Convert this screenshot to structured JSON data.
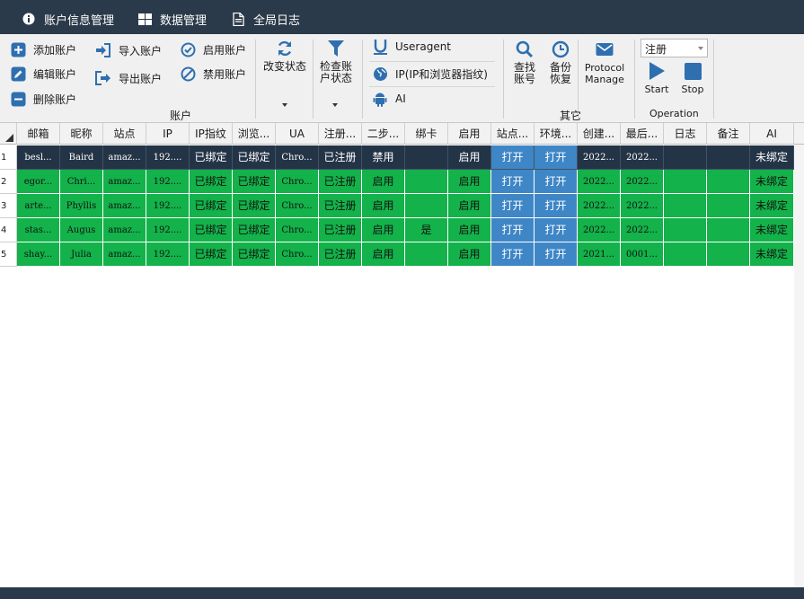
{
  "nav": {
    "tabs": [
      {
        "label": "账户信息管理",
        "icon": "info-icon"
      },
      {
        "label": "数据管理",
        "icon": "grid-icon"
      },
      {
        "label": "全局日志",
        "icon": "document-icon"
      }
    ]
  },
  "ribbon": {
    "account": {
      "add": "添加账户",
      "edit": "编辑账户",
      "delete": "删除账户",
      "import": "导入账户",
      "export": "导出账户",
      "enable": "启用账户",
      "disable": "禁用账户",
      "change_status": "改变状态",
      "check_line1": "检查账",
      "check_line2": "户状态",
      "group_label": "账户"
    },
    "middle": {
      "useragent": "Useragent",
      "ip": "IP(IP和浏览器指纹)",
      "ai": "AI"
    },
    "other": {
      "find_line1": "查找",
      "find_line2": "账号",
      "backup_line1": "备份",
      "backup_line2": "恢复",
      "protocol_line1": "Protocol",
      "protocol_line2": "Manage",
      "group_label": "其它"
    },
    "operation": {
      "combo_value": "注册",
      "start": "Start",
      "stop": "Stop",
      "group_label": "Operation"
    }
  },
  "table": {
    "columns": [
      "邮箱",
      "昵称",
      "站点",
      "IP",
      "IP指纹",
      "浏览...",
      "UA",
      "注册...",
      "二步...",
      "绑卡",
      "启用",
      "站点...",
      "环境...",
      "创建...",
      "最后...",
      "日志",
      "备注",
      "AI"
    ],
    "rows": [
      {
        "num": "1",
        "cells": [
          "besl...",
          "Baird",
          "amaz...",
          "192....",
          "已绑定",
          "已绑定",
          "Chro...",
          "已注册",
          "禁用",
          "",
          "启用",
          "打开",
          "打开",
          "2022...",
          "2022...",
          "",
          "",
          "未绑定"
        ]
      },
      {
        "num": "2",
        "cells": [
          "egor...",
          "Chri...",
          "amaz...",
          "192....",
          "已绑定",
          "已绑定",
          "Chro...",
          "已注册",
          "启用",
          "",
          "启用",
          "打开",
          "打开",
          "2022...",
          "2022...",
          "",
          "",
          "未绑定"
        ]
      },
      {
        "num": "3",
        "cells": [
          "arte...",
          "Phyllis",
          "amaz...",
          "192....",
          "已绑定",
          "已绑定",
          "Chro...",
          "已注册",
          "启用",
          "",
          "启用",
          "打开",
          "打开",
          "2022...",
          "2022...",
          "",
          "",
          "未绑定"
        ]
      },
      {
        "num": "4",
        "cells": [
          "stas...",
          "Augus",
          "amaz...",
          "192....",
          "已绑定",
          "已绑定",
          "Chro...",
          "已注册",
          "启用",
          "是",
          "启用",
          "打开",
          "打开",
          "2022...",
          "2022...",
          "",
          "",
          "未绑定"
        ]
      },
      {
        "num": "5",
        "cells": [
          "shay...",
          "Julia",
          "amaz...",
          "192....",
          "已绑定",
          "已绑定",
          "Chro...",
          "已注册",
          "启用",
          "",
          "启用",
          "打开",
          "打开",
          "2021...",
          "0001...",
          "",
          "",
          "未绑定"
        ]
      }
    ]
  },
  "colors": {
    "nav_bg": "#2b3a4a",
    "row_green": "#13b24a",
    "row_selected": "#243447",
    "button_blue": "#3f86c6",
    "icon_blue": "#2f6fb0"
  }
}
